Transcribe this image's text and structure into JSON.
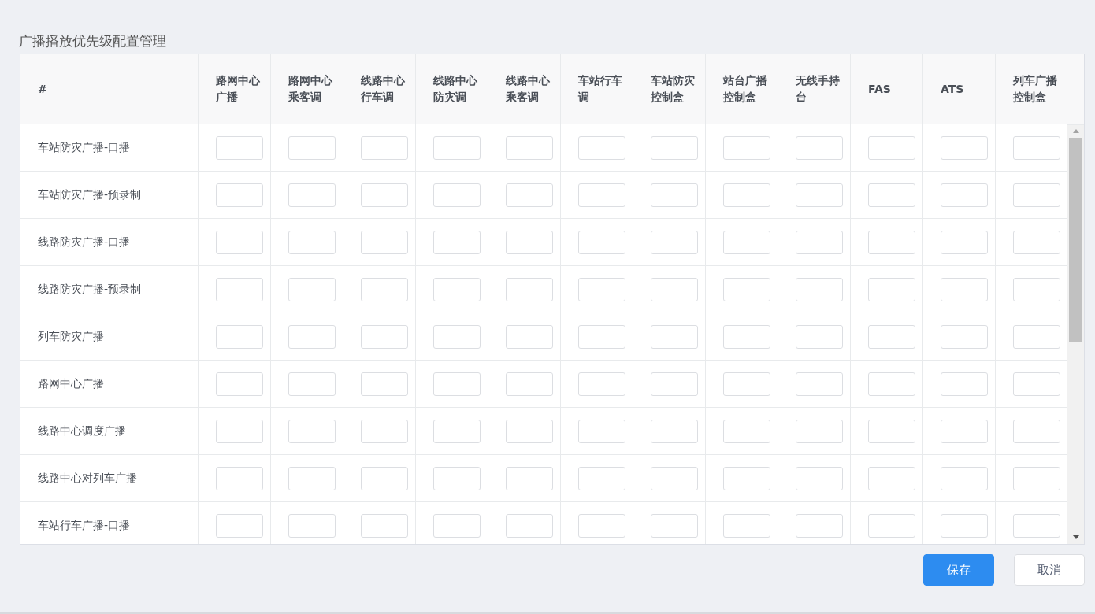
{
  "title": "广播播放优先级配置管理",
  "columns": [
    "#",
    "路网中心广播",
    "路网中心乘客调",
    "线路中心行车调",
    "线路中心防灾调",
    "线路中心乘客调",
    "车站行车调",
    "车站防灾控制盒",
    "站台广播控制盒",
    "无线手持台",
    "FAS",
    "ATS",
    "列车广播控制盒"
  ],
  "rows": [
    "车站防灾广播-口播",
    "车站防灾广播-预录制",
    "线路防灾广播-口播",
    "线路防灾广播-预录制",
    "列车防灾广播",
    "路网中心广播",
    "线路中心调度广播",
    "线路中心对列车广播",
    "车站行车广播-口播"
  ],
  "buttons": [
    {
      "label": "保存",
      "kind": "primary"
    },
    {
      "label": "取消",
      "kind": "default"
    }
  ]
}
